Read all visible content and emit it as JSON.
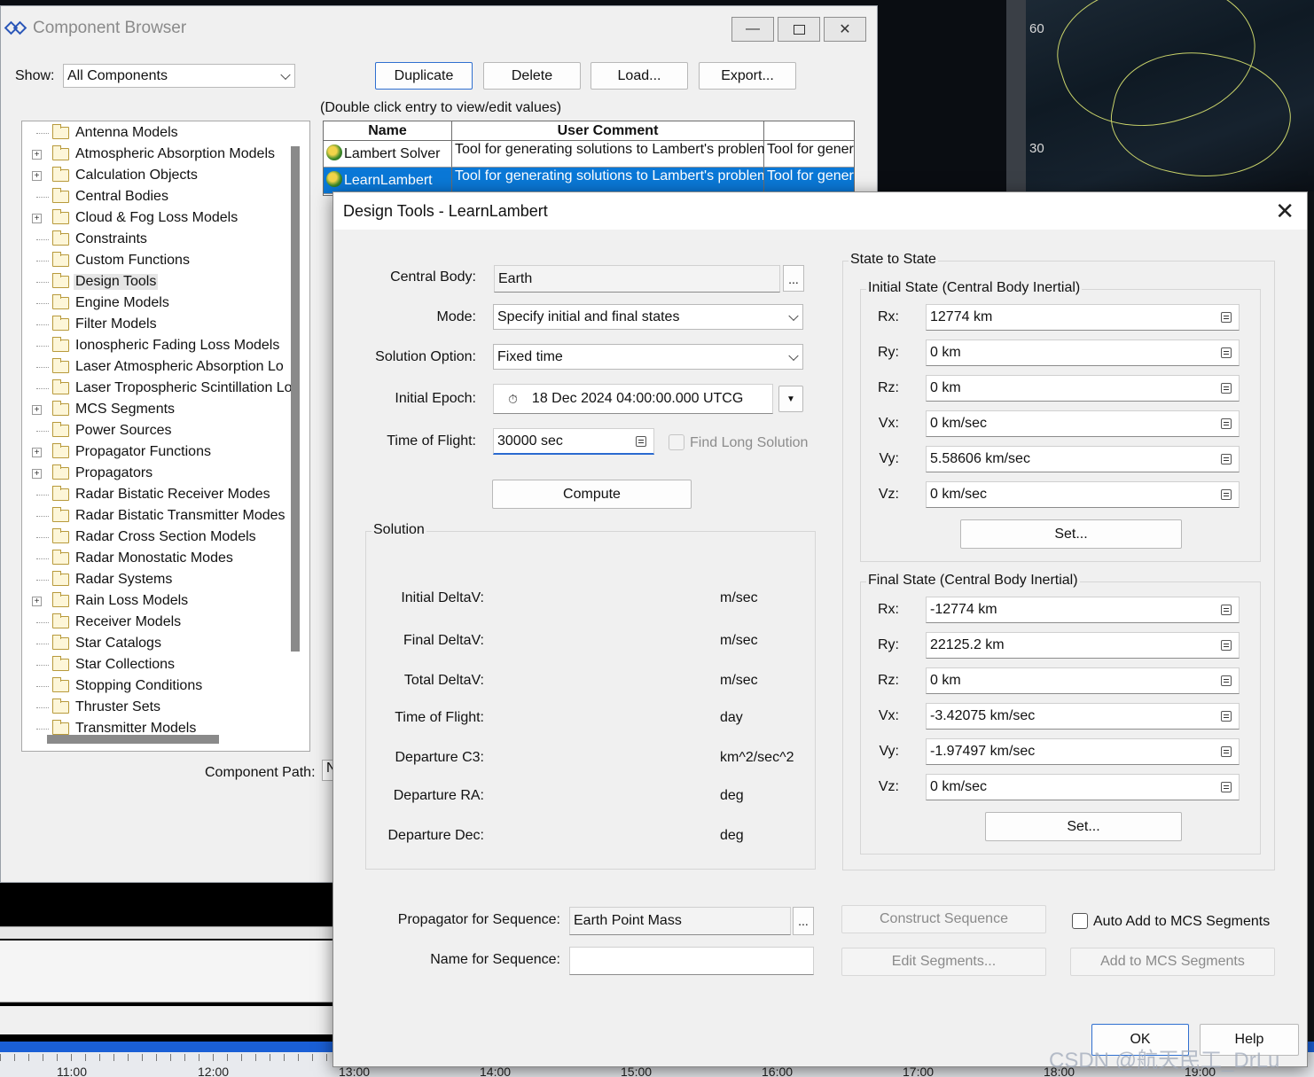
{
  "background": {
    "map_lat_labels": [
      "60",
      "30"
    ],
    "timeline_ticks": [
      "11:00",
      "12:00",
      "13:00",
      "14:00",
      "15:00",
      "16:00",
      "17:00",
      "18:00",
      "19:00"
    ]
  },
  "component_browser": {
    "title": "Component Browser",
    "window_buttons": {
      "minimize": "▭",
      "maximize": "▢",
      "close": "✕"
    },
    "show_label": "Show:",
    "show_value": "All Components",
    "buttons": {
      "duplicate": "Duplicate",
      "delete": "Delete",
      "load": "Load...",
      "export": "Export..."
    },
    "hint": "(Double click entry to view/edit values)",
    "tree": [
      {
        "label": "Antenna Models",
        "expandable": false
      },
      {
        "label": "Atmospheric Absorption Models",
        "expandable": true
      },
      {
        "label": "Calculation Objects",
        "expandable": true
      },
      {
        "label": "Central Bodies",
        "expandable": false
      },
      {
        "label": "Cloud & Fog Loss Models",
        "expandable": true
      },
      {
        "label": "Constraints",
        "expandable": false
      },
      {
        "label": "Custom Functions",
        "expandable": false
      },
      {
        "label": "Design Tools",
        "expandable": false,
        "selected": true
      },
      {
        "label": "Engine Models",
        "expandable": false
      },
      {
        "label": "Filter Models",
        "expandable": false
      },
      {
        "label": "Ionospheric Fading Loss Models",
        "expandable": false
      },
      {
        "label": "Laser Atmospheric Absorption Lo",
        "expandable": false
      },
      {
        "label": "Laser Tropospheric Scintillation Lo",
        "expandable": false
      },
      {
        "label": "MCS Segments",
        "expandable": true
      },
      {
        "label": "Power Sources",
        "expandable": false
      },
      {
        "label": "Propagator Functions",
        "expandable": true
      },
      {
        "label": "Propagators",
        "expandable": true
      },
      {
        "label": "Radar Bistatic Receiver Modes",
        "expandable": false
      },
      {
        "label": "Radar Bistatic Transmitter Modes",
        "expandable": false
      },
      {
        "label": "Radar Cross Section Models",
        "expandable": false
      },
      {
        "label": "Radar Monostatic Modes",
        "expandable": false
      },
      {
        "label": "Radar Systems",
        "expandable": false
      },
      {
        "label": "Rain Loss Models",
        "expandable": true
      },
      {
        "label": "Receiver Models",
        "expandable": false
      },
      {
        "label": "Star Catalogs",
        "expandable": false
      },
      {
        "label": "Star Collections",
        "expandable": false
      },
      {
        "label": "Stopping Conditions",
        "expandable": false
      },
      {
        "label": "Thruster Sets",
        "expandable": false
      },
      {
        "label": "Transmitter Models",
        "expandable": false
      }
    ],
    "grid": {
      "columns": [
        "Name",
        "User Comment",
        ""
      ],
      "rows": [
        {
          "name": "Lambert Solver",
          "comment": "Tool for generating solutions to Lambert's problem",
          "extra": "Tool for genera",
          "selected": false
        },
        {
          "name": "LearnLambert",
          "comment": "Tool for generating solutions to Lambert's problem",
          "extra": "Tool for genera",
          "selected": true
        }
      ]
    },
    "component_path_label": "Component Path:",
    "component_path_value": "N"
  },
  "design_tools": {
    "title": "Design Tools - LearnLambert",
    "central_body_label": "Central Body:",
    "central_body_value": "Earth",
    "mode_label": "Mode:",
    "mode_value": "Specify initial and final states",
    "solution_option_label": "Solution Option:",
    "solution_option_value": "Fixed time",
    "initial_epoch_label": "Initial Epoch:",
    "initial_epoch_value": "18 Dec 2024 04:00:00.000 UTCG",
    "time_of_flight_label": "Time of Flight:",
    "time_of_flight_value": "30000 sec",
    "find_long_solution": "Find Long Solution",
    "compute": "Compute",
    "solution": {
      "title": "Solution",
      "rows": [
        {
          "label": "Initial DeltaV:",
          "unit": "m/sec"
        },
        {
          "label": "Final DeltaV:",
          "unit": "m/sec"
        },
        {
          "label": "Total DeltaV:",
          "unit": "m/sec"
        },
        {
          "label": "Time of Flight:",
          "unit": "day"
        },
        {
          "label": "Departure C3:",
          "unit": "km^2/sec^2"
        },
        {
          "label": "Departure RA:",
          "unit": "deg"
        },
        {
          "label": "Departure Dec:",
          "unit": "deg"
        }
      ]
    },
    "state_to_state": {
      "title": "State to State",
      "initial": {
        "title": "Initial State (Central Body Inertial)",
        "rows": [
          {
            "label": "Rx:",
            "value": "12774 km"
          },
          {
            "label": "Ry:",
            "value": "0 km"
          },
          {
            "label": "Rz:",
            "value": "0 km"
          },
          {
            "label": "Vx:",
            "value": "0 km/sec"
          },
          {
            "label": "Vy:",
            "value": "5.58606 km/sec"
          },
          {
            "label": "Vz:",
            "value": "0 km/sec"
          }
        ],
        "set": "Set..."
      },
      "final": {
        "title": "Final State  (Central Body Inertial)",
        "rows": [
          {
            "label": "Rx:",
            "value": "-12774 km"
          },
          {
            "label": "Ry:",
            "value": "22125.2 km"
          },
          {
            "label": "Rz:",
            "value": "0 km"
          },
          {
            "label": "Vx:",
            "value": "-3.42075 km/sec"
          },
          {
            "label": "Vy:",
            "value": "-1.97497 km/sec"
          },
          {
            "label": "Vz:",
            "value": "0 km/sec"
          }
        ],
        "set": "Set..."
      }
    },
    "propagator_label": "Propagator for Sequence:",
    "propagator_value": "Earth Point Mass",
    "name_for_sequence_label": "Name for Sequence:",
    "name_for_sequence_value": "",
    "construct_sequence": "Construct Sequence",
    "edit_segments": "Edit Segments...",
    "auto_add": "Auto Add to MCS Segments",
    "add_to_mcs": "Add to MCS Segments",
    "ok": "OK",
    "help": "Help"
  },
  "watermark": "CSDN @航天民工_DrLu"
}
